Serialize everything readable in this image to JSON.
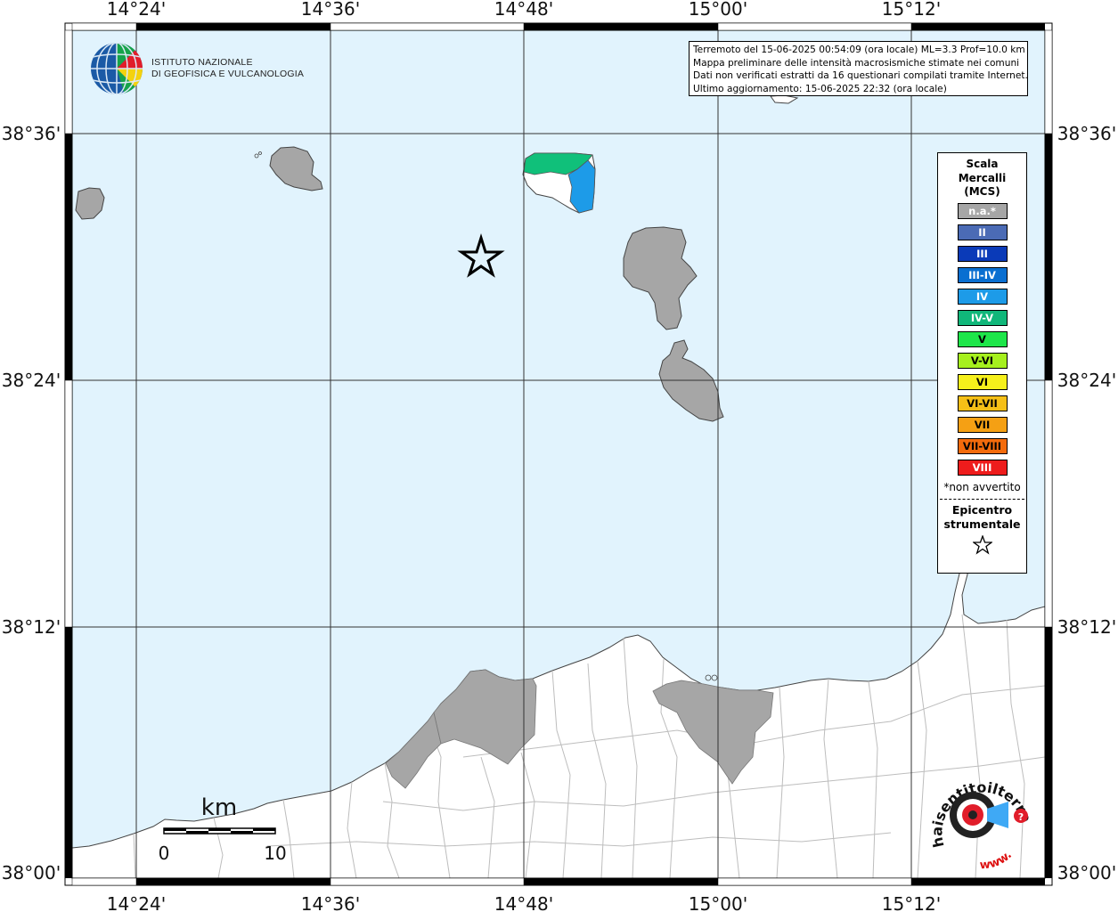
{
  "lon_ticks": [
    "14°24'",
    "14°36'",
    "14°48'",
    "15°00'",
    "15°12'"
  ],
  "lat_ticks": [
    "38°36'",
    "38°24'",
    "38°12'",
    "38°00'"
  ],
  "info": {
    "line1": "Terremoto del 15-06-2025 00:54:09 (ora locale) ML=3.3 Prof=10.0 km",
    "line2": "Mappa preliminare delle intensità macrosismiche stimate nei comuni",
    "line3": "Dati non verificati estratti da 16 questionari compilati tramite Internet.",
    "line4": "Ultimo aggiornamento: 15-06-2025 22:32 (ora locale)"
  },
  "institute": {
    "line1": "ISTITUTO NAZIONALE",
    "line2": "DI GEOFISICA E VULCANOLOGIA"
  },
  "legend": {
    "title1": "Scala",
    "title2": "Mercalli",
    "title3": "(MCS)",
    "items": [
      {
        "label": "n.a.*",
        "color": "#a6a6a6"
      },
      {
        "label": "II",
        "color": "#4b6bb5"
      },
      {
        "label": "III",
        "color": "#0a3ab8"
      },
      {
        "label": "III-IV",
        "color": "#0a6fd1"
      },
      {
        "label": "IV",
        "color": "#1d9be8"
      },
      {
        "label": "IV-V",
        "color": "#10b77a"
      },
      {
        "label": "V",
        "color": "#1ee64a"
      },
      {
        "label": "V-VI",
        "color": "#a6f01e"
      },
      {
        "label": "VI",
        "color": "#f6f01b"
      },
      {
        "label": "VI-VII",
        "color": "#f5bf17"
      },
      {
        "label": "VII",
        "color": "#f5a014"
      },
      {
        "label": "VII-VIII",
        "color": "#f36b0c"
      },
      {
        "label": "VIII",
        "color": "#ee1c1c"
      }
    ],
    "note": "*non avvertito",
    "epi1": "Epicentro",
    "epi2": "strumentale"
  },
  "scale_bar": {
    "unit": "km",
    "min": "0",
    "max": "10"
  },
  "watermark": {
    "text1": "haisentitoilterremoto.it",
    "text2": "www."
  },
  "colors": {
    "sea": "#e1f3fd",
    "land": "#ffffff",
    "na": "#a6a6a6"
  }
}
